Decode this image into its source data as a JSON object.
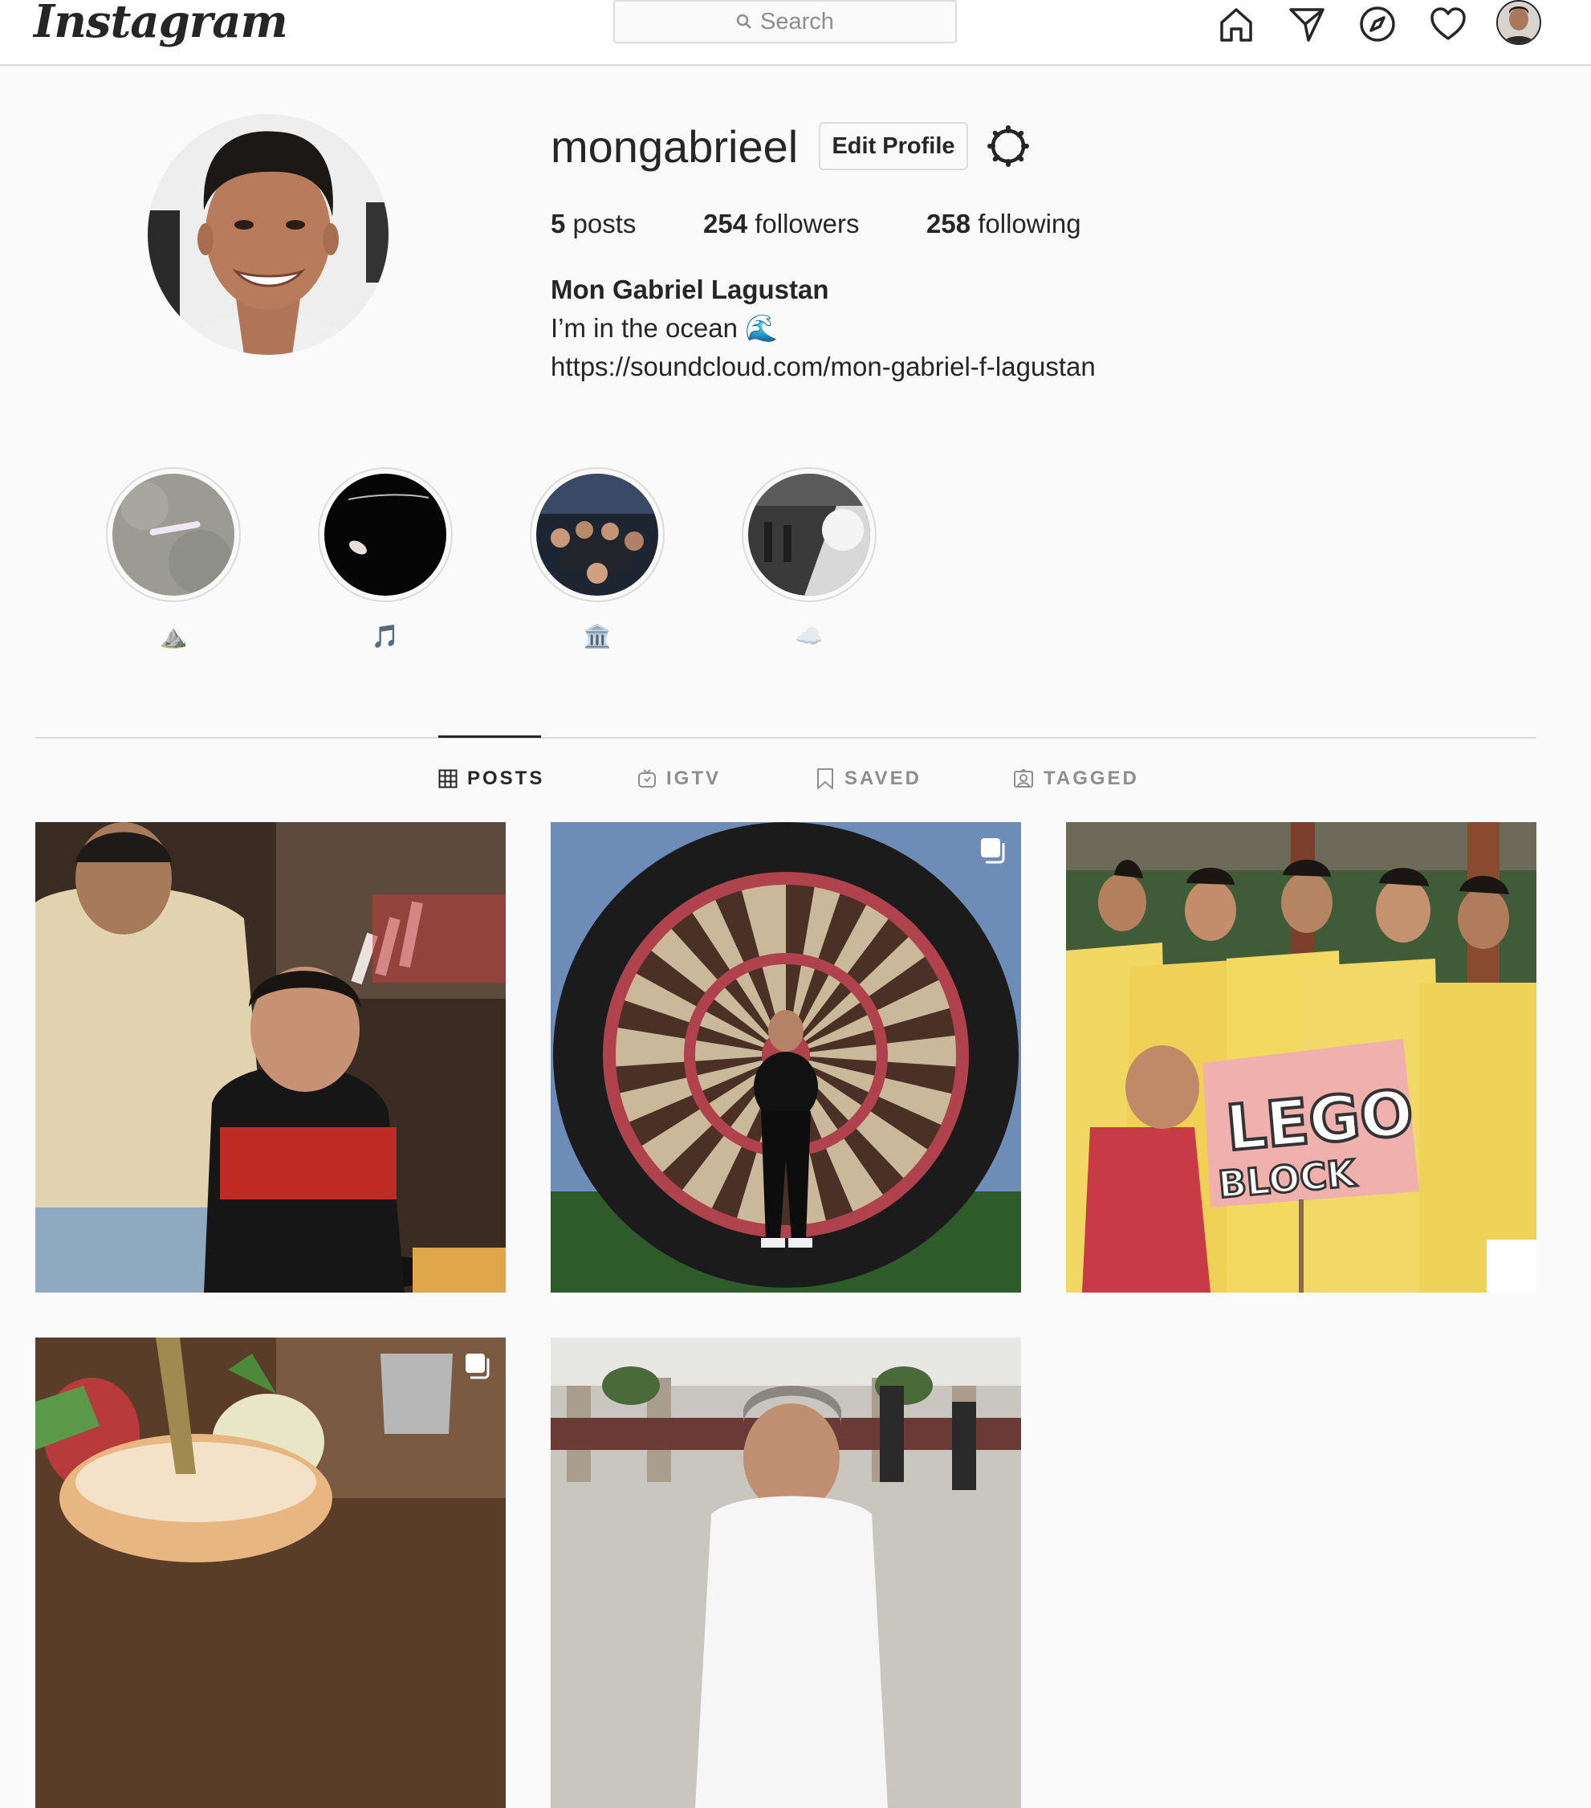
{
  "nav": {
    "logo": "Instagram",
    "search_placeholder": "Search",
    "icons": [
      "home-icon",
      "direct-icon",
      "explore-icon",
      "activity-heart-icon",
      "profile-avatar"
    ]
  },
  "profile": {
    "username": "mongabrieel",
    "edit_label": "Edit Profile",
    "stats": {
      "posts_count": "5",
      "posts_label": " posts",
      "followers_count": "254",
      "followers_label": " followers",
      "following_count": "258",
      "following_label": " following"
    },
    "full_name": "Mon Gabriel Lagustan",
    "bio": "I’m in the ocean 🌊",
    "link": "https://soundcloud.com/mon-gabriel-f-lagustan"
  },
  "highlights": [
    {
      "label": "⛰️"
    },
    {
      "label": "🎵"
    },
    {
      "label": "🏛️"
    },
    {
      "label": "☁️"
    }
  ],
  "tabs": [
    {
      "label": "POSTS",
      "icon": "grid-icon",
      "active": true
    },
    {
      "label": "IGTV",
      "icon": "igtv-icon",
      "active": false
    },
    {
      "label": "SAVED",
      "icon": "bookmark-icon",
      "active": false
    },
    {
      "label": "TAGGED",
      "icon": "tagged-icon",
      "active": false
    }
  ],
  "colors": {
    "text": "#262626",
    "muted": "#8e8e8e",
    "border": "#dbdbdb",
    "background": "#fafafa"
  }
}
